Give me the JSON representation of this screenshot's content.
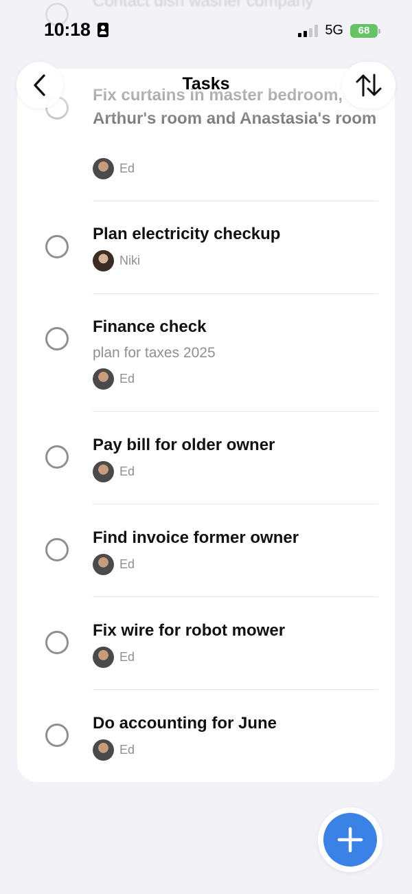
{
  "status_bar": {
    "time": "10:18",
    "network": "5G",
    "battery": "68"
  },
  "ghost": {
    "text": "Contact dish washer company"
  },
  "nav": {
    "title": "Tasks",
    "back_icon": "chevron-left-icon",
    "sort_icon": "sort-arrows-icon"
  },
  "tasks": [
    {
      "title": "Fix curtains in master bedroom, Arthur's room and Anastasia's room",
      "assignee": "Ed"
    },
    {
      "title": "Plan electricity checkup",
      "assignee": "Niki"
    },
    {
      "title": "Finance check",
      "note": "plan for taxes 2025",
      "assignee": "Ed"
    },
    {
      "title": "Pay bill for older owner",
      "assignee": "Ed"
    },
    {
      "title": "Find invoice former owner",
      "assignee": "Ed"
    },
    {
      "title": "Fix wire for robot mower",
      "assignee": "Ed"
    },
    {
      "title": "Do accounting for June",
      "assignee": "Ed"
    }
  ],
  "fab": {
    "icon": "plus-icon",
    "color": "#3b82e6"
  }
}
